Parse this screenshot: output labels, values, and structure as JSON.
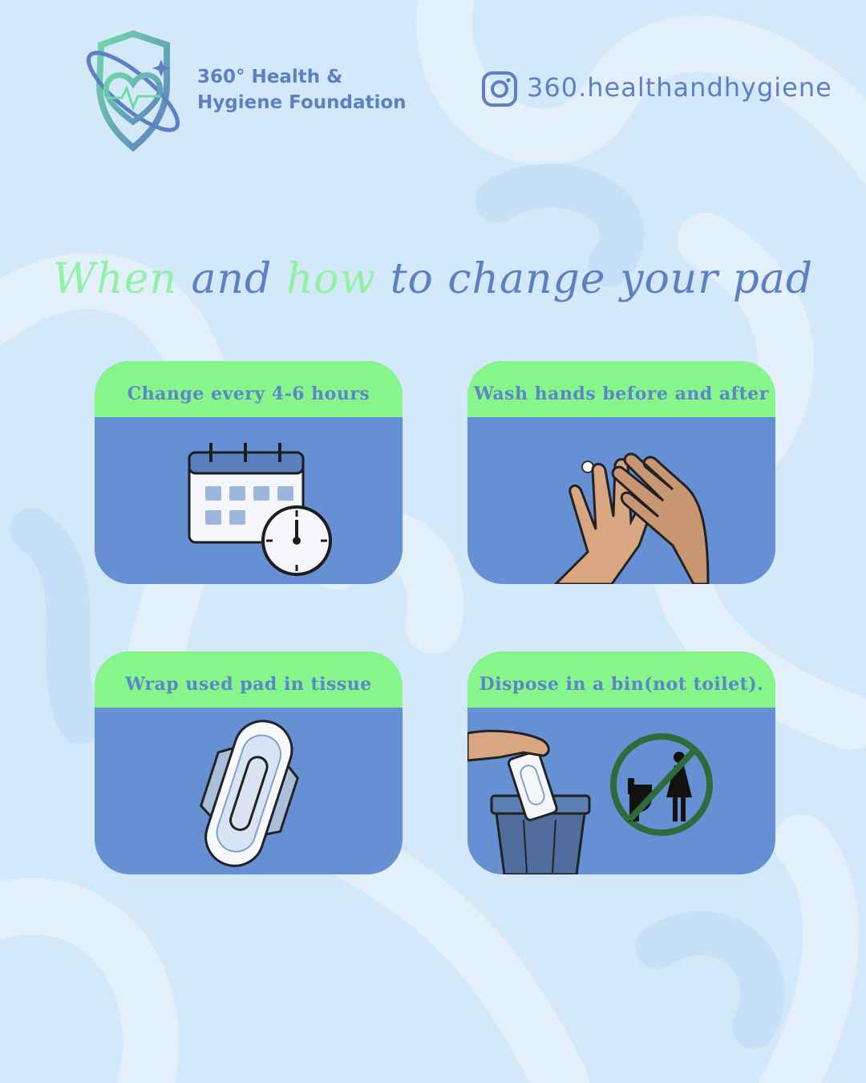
{
  "header": {
    "org_line1": "360° Health &",
    "org_line2": "Hygiene Foundation",
    "instagram_handle": "360.healthandhygiene",
    "logo_icon": "heart-shield-logo-icon",
    "social_icon": "instagram-icon"
  },
  "title": {
    "part1": "When",
    "part2": " and ",
    "part3": "how",
    "part4": " to change your pad"
  },
  "cards": [
    {
      "heading": "Change every 4-6 hours",
      "icon": "calendar-clock-icon"
    },
    {
      "heading": "Wash hands before and after",
      "icon": "washing-hands-icon"
    },
    {
      "heading": "Wrap used pad in tissue",
      "icon": "sanitary-pad-icon"
    },
    {
      "heading": "Dispose in a bin(not toilet).",
      "icon": "bin-disposal-icon"
    }
  ],
  "colors": {
    "background": "#d3e8f9",
    "accent_blue": "#5d80c4",
    "accent_green": "#86f68a",
    "card_blue": "#6590d4"
  }
}
